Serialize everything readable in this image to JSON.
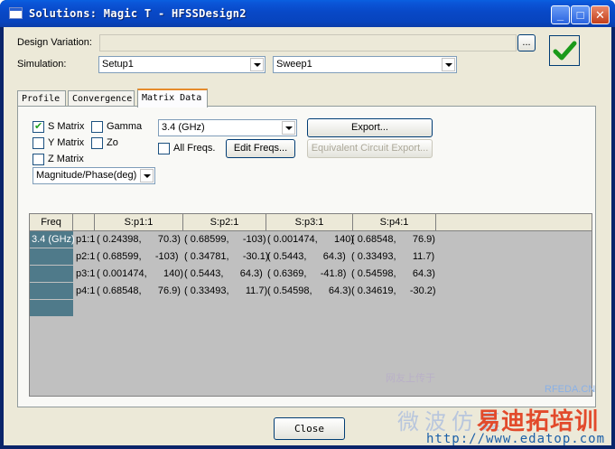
{
  "window": {
    "title": "Solutions: Magic T - HFSSDesign2",
    "minimize": "_",
    "maximize": "□",
    "close": "✕"
  },
  "design_variation": {
    "label": "Design Variation:",
    "value": "",
    "browse": "..."
  },
  "simulation": {
    "label": "Simulation:",
    "setup": "Setup1",
    "sweep": "Sweep1"
  },
  "tabs": [
    {
      "label": "Profile",
      "active": false
    },
    {
      "label": "Convergence",
      "active": false
    },
    {
      "label": "Matrix Data",
      "active": true
    }
  ],
  "options": {
    "s_matrix": "S Matrix",
    "gamma": "Gamma",
    "y_matrix": "Y Matrix",
    "zo": "Zo",
    "z_matrix": "Z Matrix",
    "format": "Magnitude/Phase(deg)",
    "frequency": "3.4 (GHz)",
    "all_freqs": "All Freqs.",
    "edit_freqs": "Edit Freqs...",
    "export": "Export...",
    "equiv_export": "Equivalent Circuit Export..."
  },
  "table": {
    "headers": [
      "Freq",
      "",
      "S:p1:1",
      "S:p2:1",
      "S:p3:1",
      "S:p4:1"
    ],
    "freq": "3.4 (GHz)",
    "rows": [
      {
        "port": "p1:1",
        "cells": [
          "( 0.24398,      70.3)",
          "( 0.68599,     -103)",
          "( 0.001474,      140)",
          "( 0.68548,      76.9)"
        ]
      },
      {
        "port": "p2:1",
        "cells": [
          "( 0.68599,     -103)",
          "( 0.34781,     -30.1)",
          "( 0.5443,      64.3)",
          "( 0.33493,      11.7)"
        ]
      },
      {
        "port": "p3:1",
        "cells": [
          "( 0.001474,      140)",
          "( 0.5443,      64.3)",
          "( 0.6369,     -41.8)",
          "( 0.54598,      64.3)"
        ]
      },
      {
        "port": "p4:1",
        "cells": [
          "( 0.68548,      76.9)",
          "( 0.33493,      11.7)",
          "( 0.54598,      64.3)",
          "( 0.34619,     -30.2)"
        ]
      }
    ]
  },
  "close_button": "Close",
  "watermark": {
    "line1": "网友上传于",
    "brand": "RFEDA.CN",
    "cn": "微波仿真",
    "cn2": "易迪拓培训",
    "url": "http://www.edatop.com"
  }
}
